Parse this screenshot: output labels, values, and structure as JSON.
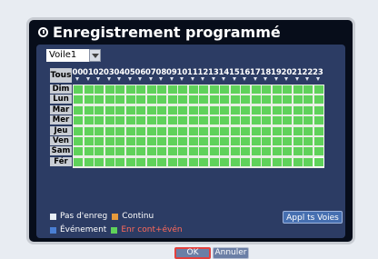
{
  "dialog": {
    "title": "Enregistrement programmé"
  },
  "channel_select": {
    "value": "Voile1"
  },
  "grid": {
    "all_label": "Tous",
    "hours": [
      "00",
      "01",
      "02",
      "03",
      "04",
      "05",
      "06",
      "07",
      "08",
      "09",
      "10",
      "11",
      "12",
      "13",
      "14",
      "15",
      "16",
      "17",
      "18",
      "19",
      "20",
      "21",
      "22",
      "23"
    ],
    "days": [
      "Dim",
      "Lun",
      "Mar",
      "Mer",
      "Jeu",
      "Ven",
      "Sam",
      "Fér"
    ],
    "cell_mode": "Enr cont+évén"
  },
  "legend": {
    "none": {
      "label": "Pas d'enreg",
      "color": "#e8eef5"
    },
    "continuous": {
      "label": "Continu",
      "color": "#e69a3c"
    },
    "event": {
      "label": "Événement",
      "color": "#4a7fd4"
    },
    "cont_event": {
      "label": "Enr cont+évén",
      "color": "#5fd25a"
    }
  },
  "buttons": {
    "apply_all": "Appl ts Voies",
    "ok": "OK",
    "cancel": "Annuler"
  }
}
